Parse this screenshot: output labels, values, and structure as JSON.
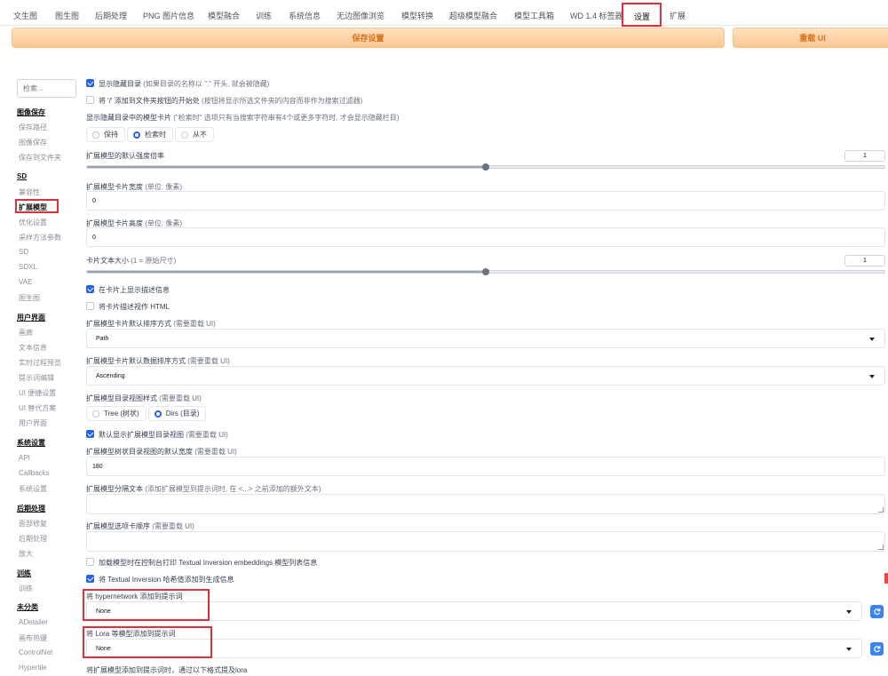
{
  "tabs": [
    {
      "label": "文生图"
    },
    {
      "label": "图生图"
    },
    {
      "label": "后期处理"
    },
    {
      "label": "PNG 图片信息"
    },
    {
      "label": "模型融合"
    },
    {
      "label": "训练"
    },
    {
      "label": "系统信息"
    },
    {
      "label": "无边图像浏览"
    },
    {
      "label": "模型转换"
    },
    {
      "label": "超级模型融合"
    },
    {
      "label": "模型工具箱"
    },
    {
      "label": "WD 1.4 标签器"
    },
    {
      "label": "设置"
    },
    {
      "label": "扩展"
    }
  ],
  "actions": {
    "save": "保存设置",
    "reload": "重载 UI"
  },
  "sidebar": {
    "search_placeholder": "检索...",
    "groups": [
      {
        "title": "图像保存",
        "items": [
          "保存路径",
          "图像保存",
          "保存到文件夹"
        ]
      },
      {
        "title": "SD",
        "items": [
          "兼容性",
          "扩展模型",
          "优化设置",
          "采样方法参数",
          "SD",
          "SDXL",
          "VAE",
          "图生图"
        ]
      },
      {
        "title": "用户界面",
        "items": [
          "画廊",
          "文本信息",
          "实时过程预览",
          "提示词编辑",
          "UI 便捷设置",
          "UI 替代方案",
          "用户界面"
        ]
      },
      {
        "title": "系统设置",
        "items": [
          "API",
          "Callbacks",
          "系统设置"
        ]
      },
      {
        "title": "后期处理",
        "items": [
          "面部修复",
          "后期处理",
          "放大"
        ]
      },
      {
        "title": "训练",
        "items": [
          "训练"
        ]
      },
      {
        "title": "未分类",
        "items": [
          "ADetailer",
          "画布热键",
          "ControlNet",
          "Hypertile"
        ]
      }
    ]
  },
  "settings": {
    "show_hidden_dirs": {
      "label": "显示隐藏目录",
      "hint": "(如果目录的名称以 \".\" 开头, 就会被隐藏)"
    },
    "add_slash": {
      "label": "将 '/' 添加到文件夹按钮的开始处",
      "hint": "(按钮将显示所选文件夹的内容而非作为搜索过滤器)"
    },
    "hidden_cards": {
      "label": "显示隐藏目录中的模型卡片",
      "hint": "(\"检索时\" 选项只有当搜索字符串有4个或更多字符时, 才会显示隐藏栏目)",
      "options": [
        "保持",
        "检索时",
        "从不"
      ]
    },
    "default_multiplier": {
      "label": "扩展模型的默认强度倍率",
      "value": "1",
      "fill": 0.5
    },
    "card_width": {
      "label": "扩展模型卡片宽度",
      "hint": "(单位: 像素)",
      "value": "0"
    },
    "card_height": {
      "label": "扩展模型卡片高度",
      "hint": "(单位: 像素)",
      "value": "0"
    },
    "text_scale": {
      "label": "卡片文本大小",
      "hint": "(1 = 原始尺寸)",
      "value": "1",
      "fill": 0.5
    },
    "show_desc": {
      "label": "在卡片上显示描述信息"
    },
    "desc_html": {
      "label": "将卡片描述视作 HTML"
    },
    "sort_field": {
      "label": "扩展模型卡片默认排序方式",
      "hint": "(需要重载 UI)",
      "value": "Path"
    },
    "sort_order": {
      "label": "扩展模型卡片默认数据排序方式",
      "hint": "(需要重载 UI)",
      "value": "Ascending"
    },
    "tree_view_style": {
      "label": "扩展模型目录视图样式",
      "hint": "(需要重载 UI)",
      "options": [
        "Tree (树状)",
        "Dirs (目录)"
      ]
    },
    "default_tree_view": {
      "label": "默认显示扩展模型目录视图",
      "hint": "(需要重载 UI)"
    },
    "tree_view_width": {
      "label": "扩展模型树状目录视图的默认宽度",
      "hint": "(需要重载 UI)",
      "value": "180"
    },
    "separator_text": {
      "label": "扩展模型分隔文本",
      "hint": "(添加扩展模型到提示词时, 在 <...> 之前添加的额外文本)"
    },
    "tab_order": {
      "label": "扩展模型选项卡顺序",
      "hint": "(需要重载 UI)"
    },
    "print_ti": {
      "label": "加载模型时在控制台打印 Textual Inversion embeddings 模型列表信息"
    },
    "ti_hashes": {
      "label": "将 Textual Inversion 哈希值添加到生成信息"
    },
    "hypernet_add": {
      "label": "将 hypernetwork 添加到提示词",
      "value": "None"
    },
    "lora_add": {
      "label": "将 Lora 等模型添加到提示词",
      "value": "None"
    },
    "bottom_note": {
      "label": "将扩展模型添加到提示词时，通过以下格式提及lora"
    }
  },
  "colors": {
    "accent": "#2563eb",
    "highlight": "#e0303a",
    "button_orange": "#fbc892"
  }
}
